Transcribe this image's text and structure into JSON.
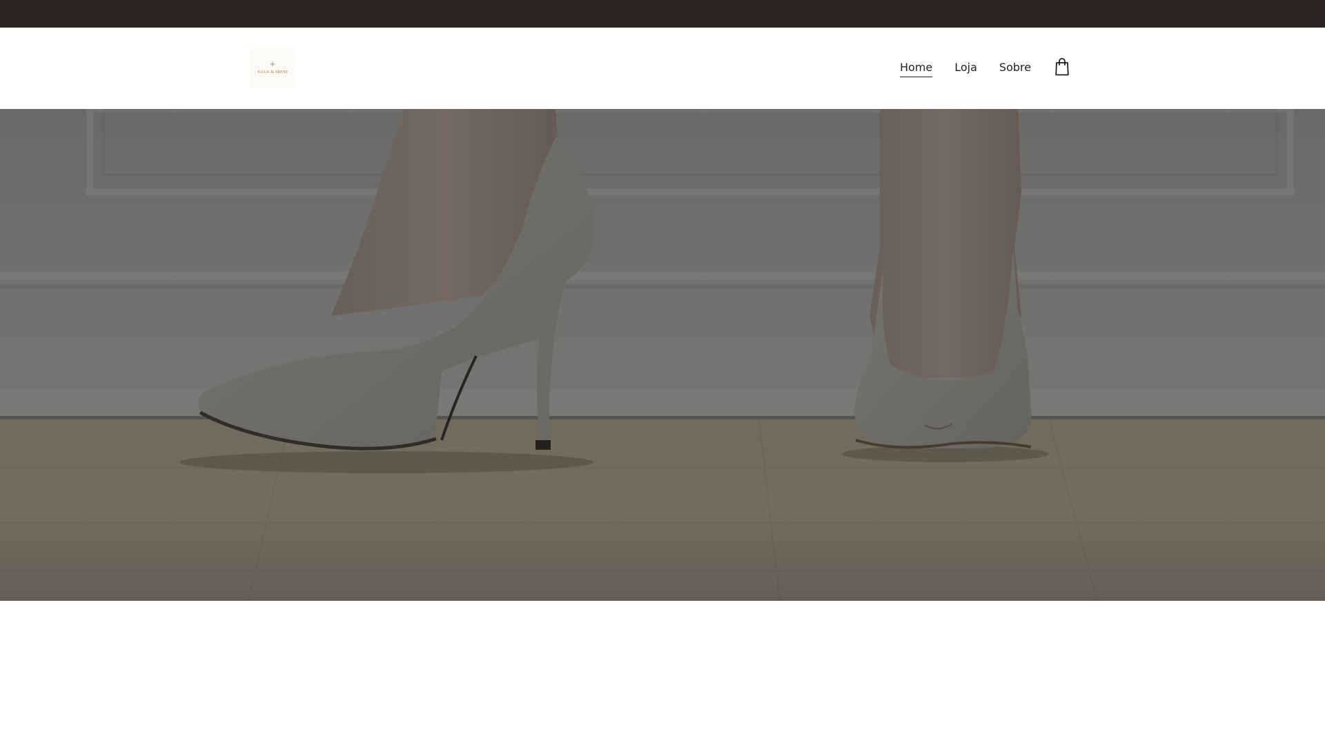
{
  "announcement": {
    "text": ""
  },
  "header": {
    "logo": {
      "mark": "+",
      "text": "WALK & SHINE"
    },
    "nav": [
      {
        "label": "Home",
        "active": true
      },
      {
        "label": "Loja",
        "active": false
      },
      {
        "label": "Sobre",
        "active": false
      }
    ],
    "cart_icon": "shopping-bag-icon"
  },
  "hero": {
    "image": "high-heel-shoes-on-wooden-floor"
  },
  "colors": {
    "announcement_bg": "#2c2220",
    "header_bg": "#ffffff",
    "text": "#1f1f1f",
    "logo_accent": "#c0763c"
  }
}
